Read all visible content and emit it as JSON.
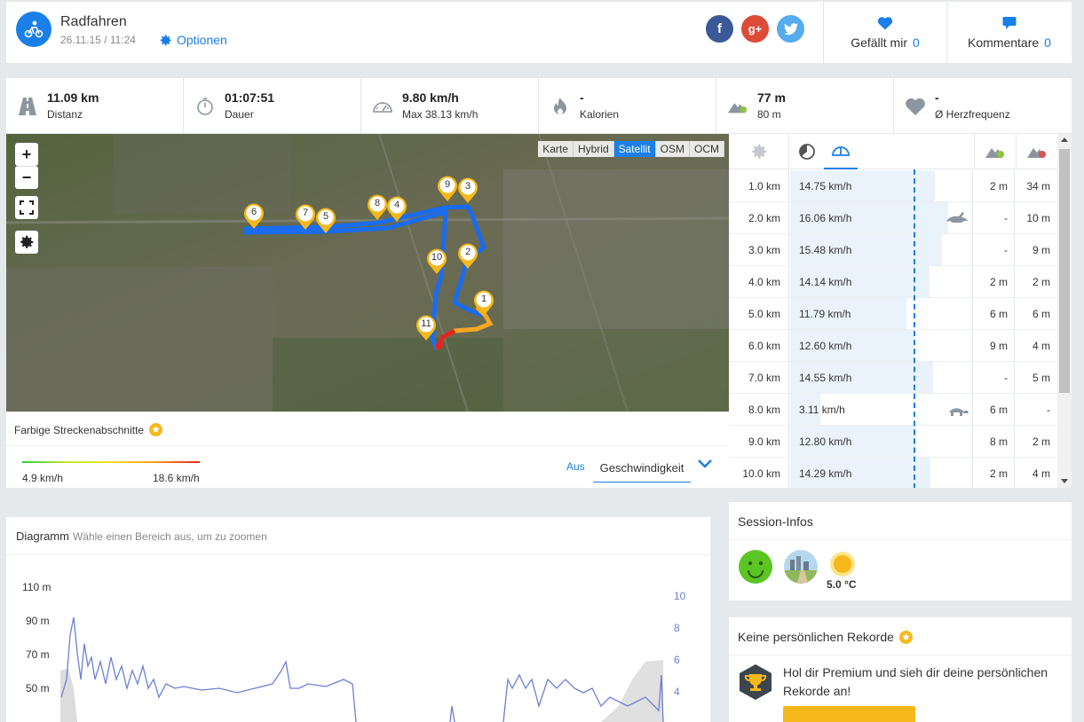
{
  "header": {
    "title": "Radfahren",
    "date": "26.11.15 / 11:24",
    "options_label": "Optionen",
    "likes_label": "Gefällt mir",
    "likes_count": "0",
    "comments_label": "Kommentare",
    "comments_count": "0"
  },
  "stats": [
    {
      "value": "11.09 km",
      "label": "Distanz",
      "icon": "road-icon"
    },
    {
      "value": "01:07:51",
      "label": "Dauer",
      "icon": "stopwatch-icon"
    },
    {
      "value": "9.80 km/h",
      "label": "Max 38.13 km/h",
      "icon": "speedometer-icon"
    },
    {
      "value": "-",
      "label": "Kalorien",
      "icon": "flame-icon"
    },
    {
      "value": "77 m",
      "label": "80 m",
      "icon": "elevation-up-icon"
    },
    {
      "value": "-",
      "label": "Ø Herzfrequenz",
      "icon": "heart-icon"
    }
  ],
  "map": {
    "types": [
      "Karte",
      "Hybrid",
      "Satellit",
      "OSM",
      "OCM"
    ],
    "active_type": "Satellit",
    "markers": [
      "1",
      "2",
      "3",
      "4",
      "5",
      "6",
      "7",
      "8",
      "9",
      "10",
      "11"
    ]
  },
  "map_footer": {
    "colored_label": "Farbige Streckenabschnitte",
    "min_speed": "4.9 km/h",
    "max_speed": "18.6 km/h",
    "aus_label": "Aus",
    "metric_label": "Geschwindigkeit"
  },
  "splits": [
    {
      "km": "1.0 km",
      "speed": "14.75 km/h",
      "speed_val": 14.75,
      "up": "2 m",
      "down": "34 m",
      "badge": ""
    },
    {
      "km": "2.0 km",
      "speed": "16.06 km/h",
      "speed_val": 16.06,
      "up": "-",
      "down": "10 m",
      "badge": "rabbit-icon"
    },
    {
      "km": "3.0 km",
      "speed": "15.48 km/h",
      "speed_val": 15.48,
      "up": "-",
      "down": "9 m",
      "badge": ""
    },
    {
      "km": "4.0 km",
      "speed": "14.14 km/h",
      "speed_val": 14.14,
      "up": "2 m",
      "down": "2 m",
      "badge": ""
    },
    {
      "km": "5.0 km",
      "speed": "11.79 km/h",
      "speed_val": 11.79,
      "up": "6 m",
      "down": "6 m",
      "badge": ""
    },
    {
      "km": "6.0 km",
      "speed": "12.60 km/h",
      "speed_val": 12.6,
      "up": "9 m",
      "down": "4 m",
      "badge": ""
    },
    {
      "km": "7.0 km",
      "speed": "14.55 km/h",
      "speed_val": 14.55,
      "up": "-",
      "down": "5 m",
      "badge": ""
    },
    {
      "km": "8.0 km",
      "speed": "3.11 km/h",
      "speed_val": 3.11,
      "up": "6 m",
      "down": "-",
      "badge": "turtle-icon"
    },
    {
      "km": "9.0 km",
      "speed": "12.80 km/h",
      "speed_val": 12.8,
      "up": "8 m",
      "down": "2 m",
      "badge": ""
    },
    {
      "km": "10.0 km",
      "speed": "14.29 km/h",
      "speed_val": 14.29,
      "up": "2 m",
      "down": "4 m",
      "badge": ""
    }
  ],
  "diagram": {
    "title": "Diagramm",
    "hint": "Wähle einen Bereich aus, um zu zoomen",
    "y_left_ticks": [
      "110 m",
      "90 m",
      "70 m",
      "50 m"
    ],
    "y_right_ticks": [
      "10",
      "8",
      "6",
      "4"
    ]
  },
  "session": {
    "title": "Session-Infos",
    "temperature": "5.0 °C"
  },
  "records": {
    "title": "Keine persönlichen Rekorde",
    "text": "Hol dir Premium und sieh dir deine persönlichen Rekorde an!"
  },
  "colors": {
    "accent": "#1a7fe8",
    "facebook": "#3b5998",
    "google": "#dd4b39",
    "twitter": "#55acee",
    "star": "#f6b81a"
  }
}
